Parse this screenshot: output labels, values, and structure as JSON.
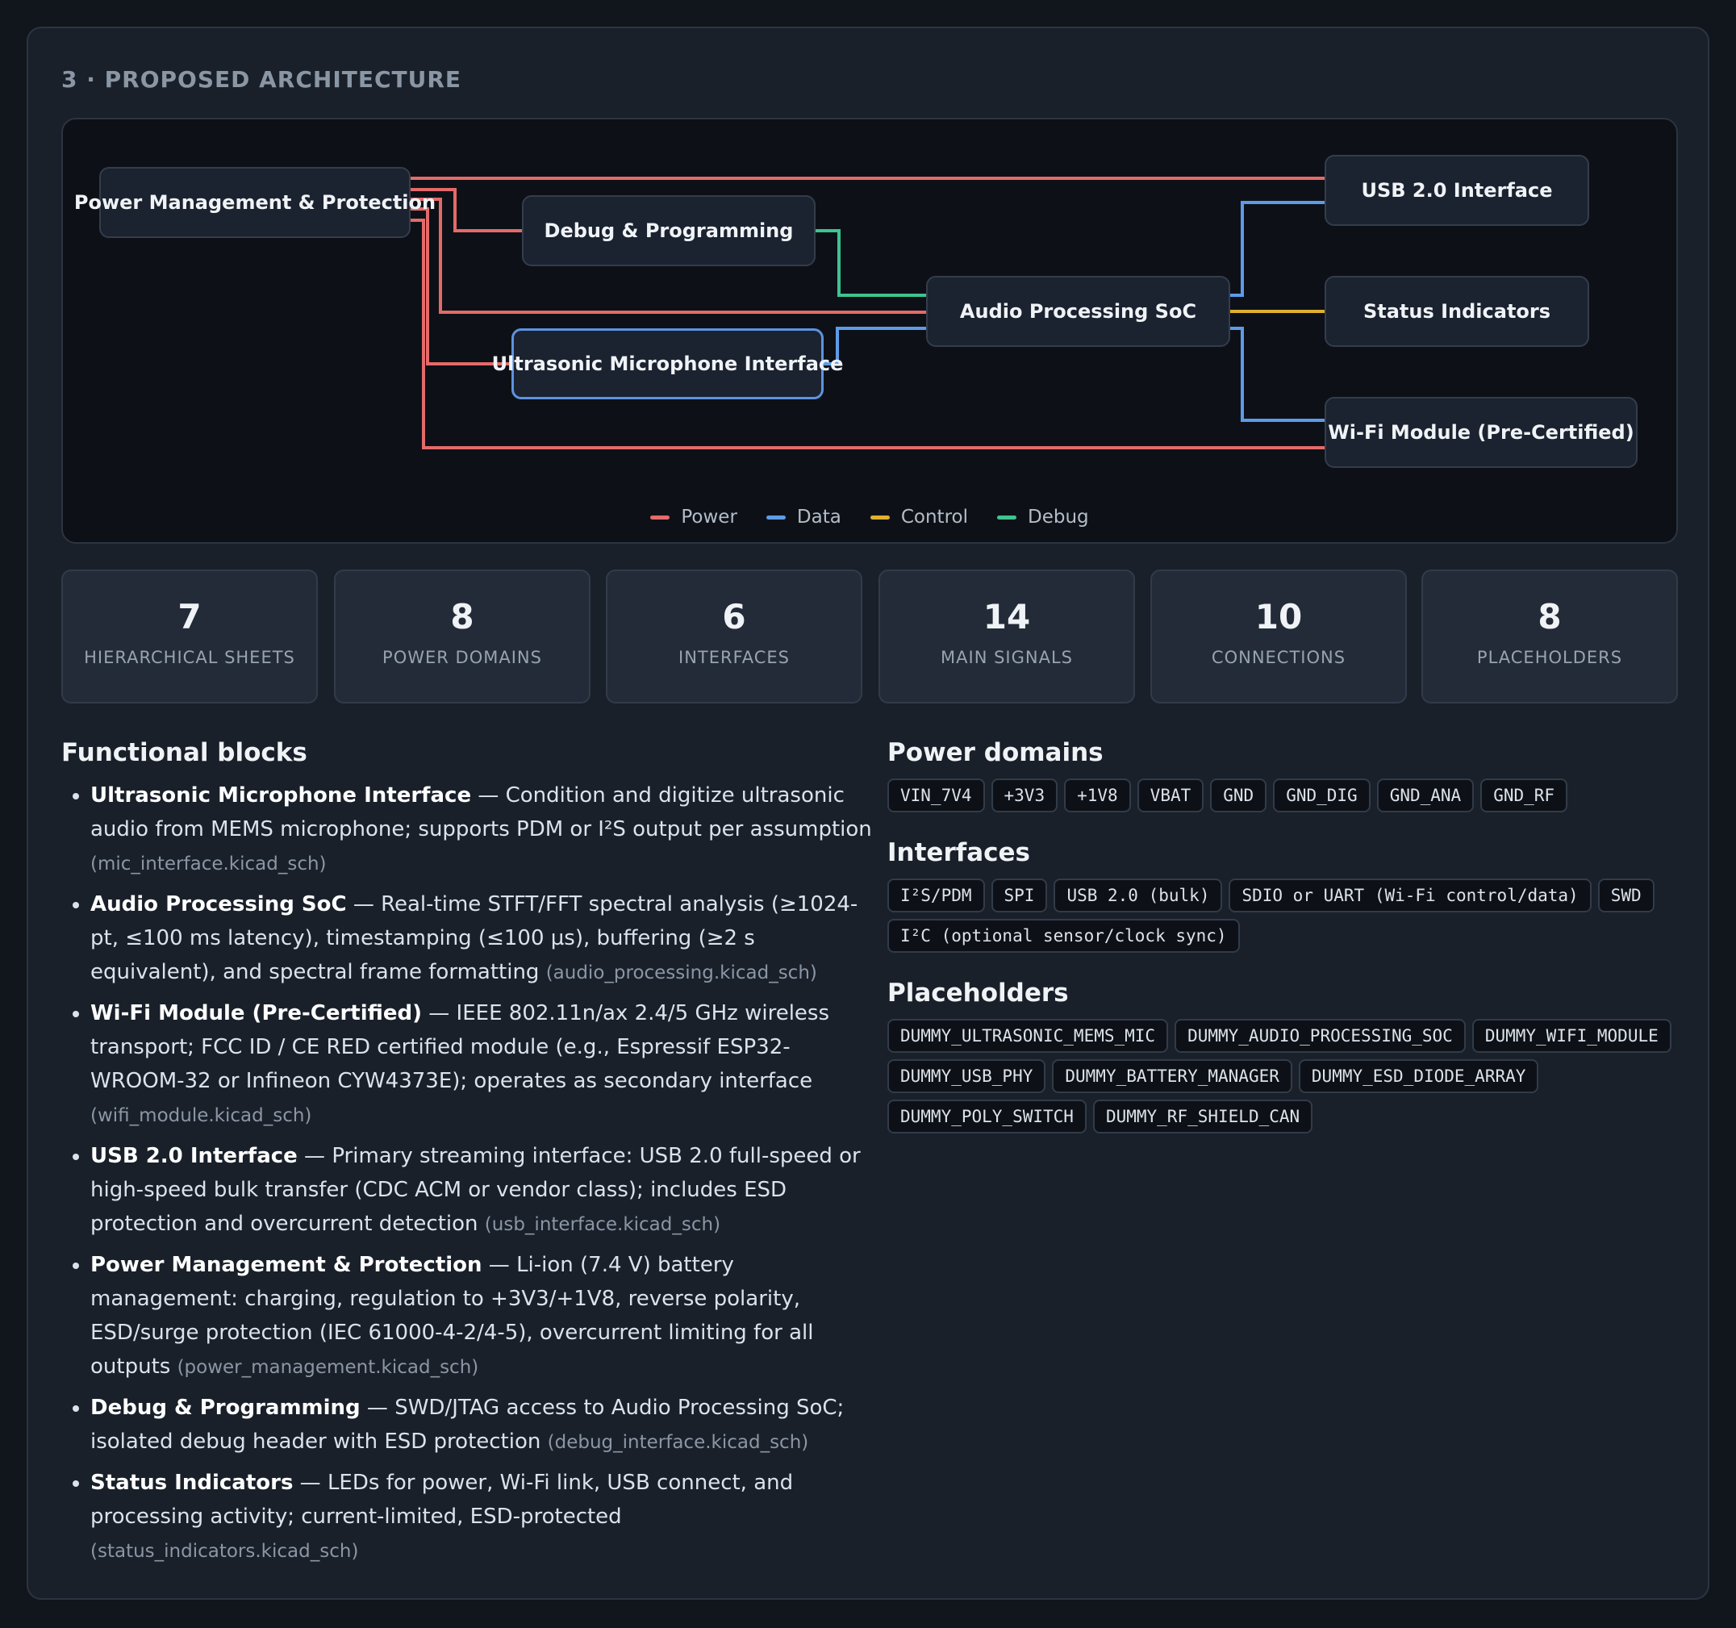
{
  "section": {
    "title": "3 · PROPOSED ARCHITECTURE"
  },
  "diagram": {
    "nodes": {
      "power": "Power Management & Protection",
      "debug": "Debug & Programming",
      "mic": "Ultrasonic Microphone Interface",
      "soc": "Audio Processing SoC",
      "usb": "USB 2.0 Interface",
      "status": "Status Indicators",
      "wifi": "Wi-Fi Module (Pre-Certified)"
    },
    "legend": {
      "power": "Power",
      "data": "Data",
      "control": "Control",
      "debug": "Debug"
    },
    "colors": {
      "power": "#e46a6a",
      "data": "#5d9be8",
      "control": "#e0b030",
      "debug": "#3dc48f"
    }
  },
  "stats": [
    {
      "value": "7",
      "label": "HIERARCHICAL SHEETS"
    },
    {
      "value": "8",
      "label": "POWER DOMAINS"
    },
    {
      "value": "6",
      "label": "INTERFACES"
    },
    {
      "value": "14",
      "label": "MAIN SIGNALS"
    },
    {
      "value": "10",
      "label": "CONNECTIONS"
    },
    {
      "value": "8",
      "label": "PLACEHOLDERS"
    }
  ],
  "functional": {
    "title": "Functional blocks",
    "items": [
      {
        "name": "Ultrasonic Microphone Interface",
        "desc": " — Condition and digitize ultrasonic audio from MEMS microphone; supports PDM or I²S output per assumption ",
        "file": "(mic_interface.kicad_sch)"
      },
      {
        "name": "Audio Processing SoC",
        "desc": " — Real-time STFT/FFT spectral analysis (≥1024-pt, ≤100 ms latency), timestamping (≤100 µs), buffering (≥2 s equivalent), and spectral frame formatting ",
        "file": "(audio_processing.kicad_sch)"
      },
      {
        "name": "Wi-Fi Module (Pre-Certified)",
        "desc": " — IEEE 802.11n/ax 2.4/5 GHz wireless transport; FCC ID / CE RED certified module (e.g., Espressif ESP32-WROOM-32 or Infineon CYW4373E); operates as secondary interface ",
        "file": "(wifi_module.kicad_sch)"
      },
      {
        "name": "USB 2.0 Interface",
        "desc": " — Primary streaming interface: USB 2.0 full-speed or high-speed bulk transfer (CDC ACM or vendor class); includes ESD protection and overcurrent detection ",
        "file": "(usb_interface.kicad_sch)"
      },
      {
        "name": "Power Management & Protection",
        "desc": " — Li-ion (7.4 V) battery management: charging, regulation to +3V3/+1V8, reverse polarity, ESD/surge protection (IEC 61000-4-2/4-5), overcurrent limiting for all outputs ",
        "file": "(power_management.kicad_sch)"
      },
      {
        "name": "Debug & Programming",
        "desc": " — SWD/JTAG access to Audio Processing SoC; isolated debug header with ESD protection ",
        "file": "(debug_interface.kicad_sch)"
      },
      {
        "name": "Status Indicators",
        "desc": " — LEDs for power, Wi-Fi link, USB connect, and processing activity; current-limited, ESD-protected ",
        "file": "(status_indicators.kicad_sch)"
      }
    ]
  },
  "power_domains": {
    "title": "Power domains",
    "tags": [
      "VIN_7V4",
      "+3V3",
      "+1V8",
      "VBAT",
      "GND",
      "GND_DIG",
      "GND_ANA",
      "GND_RF"
    ]
  },
  "interfaces": {
    "title": "Interfaces",
    "tags": [
      "I²S/PDM",
      "SPI",
      "USB 2.0 (bulk)",
      "SDIO or UART (Wi-Fi control/data)",
      "SWD",
      "I²C (optional sensor/clock sync)"
    ]
  },
  "placeholders": {
    "title": "Placeholders",
    "tags": [
      "DUMMY_ULTRASONIC_MEMS_MIC",
      "DUMMY_AUDIO_PROCESSING_SOC",
      "DUMMY_WIFI_MODULE",
      "DUMMY_USB_PHY",
      "DUMMY_BATTERY_MANAGER",
      "DUMMY_ESD_DIODE_ARRAY",
      "DUMMY_POLY_SWITCH",
      "DUMMY_RF_SHIELD_CAN"
    ]
  }
}
